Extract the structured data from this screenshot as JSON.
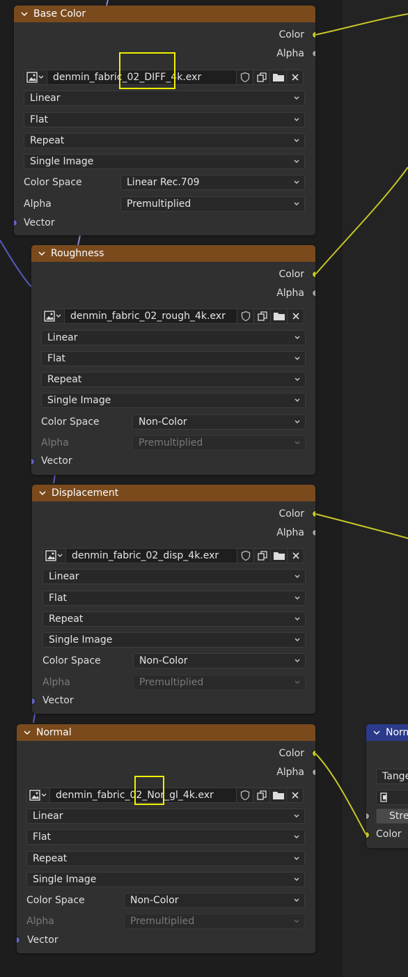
{
  "nodes": [
    {
      "title": "Base Color",
      "outputs": {
        "color": "Color",
        "alpha": "Alpha"
      },
      "image": {
        "filename": "denmin_fabric_02_DIFF_4k.exr"
      },
      "interpolation": "Linear",
      "projection": "Flat",
      "extension": "Repeat",
      "source": "Single Image",
      "color_space_label": "Color Space",
      "color_space": "Linear Rec.709",
      "alpha_label": "Alpha",
      "alpha_mode": "Premultiplied",
      "vector": "Vector"
    },
    {
      "title": "Roughness",
      "outputs": {
        "color": "Color",
        "alpha": "Alpha"
      },
      "image": {
        "filename": "denmin_fabric_02_rough_4k.exr"
      },
      "interpolation": "Linear",
      "projection": "Flat",
      "extension": "Repeat",
      "source": "Single Image",
      "color_space_label": "Color Space",
      "color_space": "Non-Color",
      "alpha_label": "Alpha",
      "alpha_mode": "Premultiplied",
      "vector": "Vector"
    },
    {
      "title": "Displacement",
      "outputs": {
        "color": "Color",
        "alpha": "Alpha"
      },
      "image": {
        "filename": "denmin_fabric_02_disp_4k.exr"
      },
      "interpolation": "Linear",
      "projection": "Flat",
      "extension": "Repeat",
      "source": "Single Image",
      "color_space_label": "Color Space",
      "color_space": "Non-Color",
      "alpha_label": "Alpha",
      "alpha_mode": "Premultiplied",
      "vector": "Vector"
    },
    {
      "title": "Normal",
      "outputs": {
        "color": "Color",
        "alpha": "Alpha"
      },
      "image": {
        "filename": "denmin_fabric_02_Nor_gl_4k.exr"
      },
      "interpolation": "Linear",
      "projection": "Flat",
      "extension": "Repeat",
      "source": "Single Image",
      "color_space_label": "Color Space",
      "color_space": "Non-Color",
      "alpha_label": "Alpha",
      "alpha_mode": "Premultiplied",
      "vector": "Vector"
    }
  ],
  "normal_map_node": {
    "title": "Norm",
    "space": "Tange",
    "strength": "Stre",
    "color_input": "Color"
  },
  "colors": {
    "header_orange": "#7a4a1d",
    "header_blue": "#2b3a8a",
    "socket_yellow": "#c7c729",
    "socket_gray": "#a1a1a1",
    "socket_blue": "#6363c7",
    "highlight": "#f0f000"
  }
}
